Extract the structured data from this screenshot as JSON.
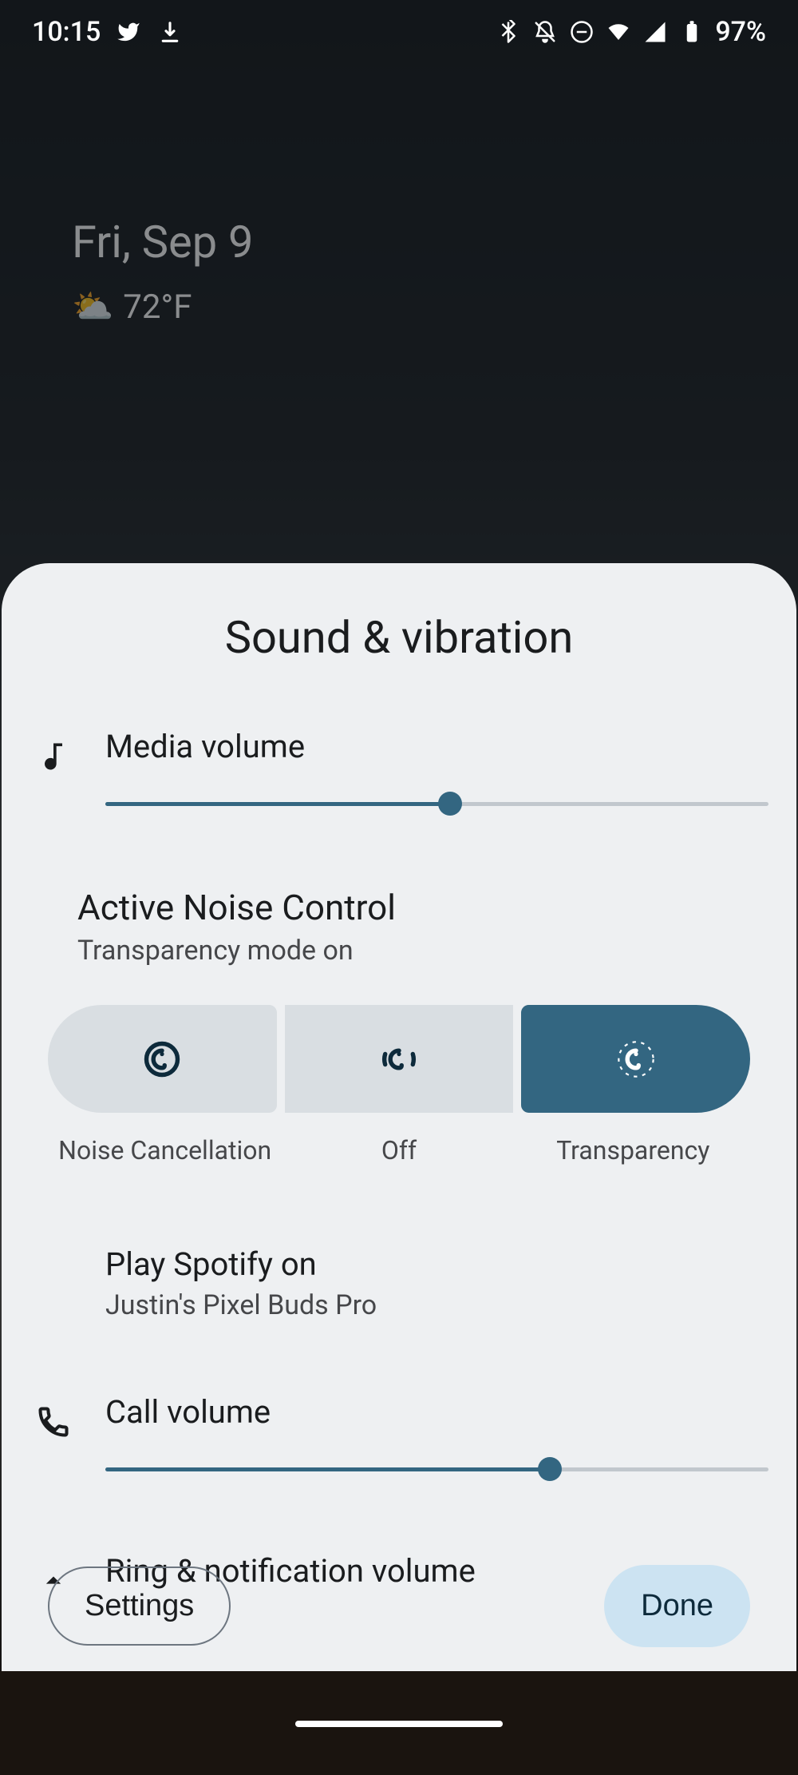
{
  "status": {
    "time": "10:15",
    "battery_pct": "97%"
  },
  "home": {
    "date": "Fri, Sep 9",
    "weather": "72°F"
  },
  "sheet": {
    "title": "Sound & vibration",
    "media": {
      "label": "Media volume",
      "value_pct": 52
    },
    "anc": {
      "title": "Active Noise Control",
      "subtitle": "Transparency mode on",
      "options": [
        "Noise Cancellation",
        "Off",
        "Transparency"
      ],
      "selected": "Transparency"
    },
    "output": {
      "label": "Play Spotify on",
      "device": "Justin's Pixel Buds Pro"
    },
    "call": {
      "label": "Call volume",
      "value_pct": 67
    },
    "ring": {
      "label": "Ring & notification volume"
    },
    "settings_btn": "Settings",
    "done_btn": "Done"
  }
}
